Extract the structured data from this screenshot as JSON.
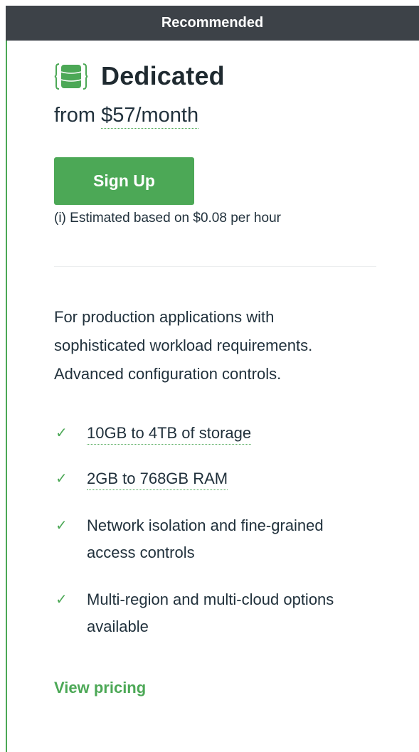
{
  "banner": {
    "label": "Recommended"
  },
  "plan": {
    "icon": "database-icon",
    "title": "Dedicated",
    "price_prefix": "from",
    "price_value": "$57/month",
    "signup_label": "Sign Up",
    "estimate_note": "(i) Estimated based on $0.08 per hour"
  },
  "description": {
    "lines": [
      "For production applications with",
      "sophisticated workload requirements.",
      "Advanced configuration controls."
    ]
  },
  "features": [
    {
      "lines": [
        "10GB to 4TB of storage"
      ],
      "icon": "check-icon"
    },
    {
      "lines": [
        "2GB to 768GB RAM"
      ],
      "icon": "check-icon"
    },
    {
      "lines": [
        "Network isolation and fine-grained",
        "access controls"
      ],
      "icon": "check-icon"
    },
    {
      "lines": [
        "Multi-region and multi-cloud options",
        "available"
      ],
      "icon": "check-icon"
    }
  ],
  "link": {
    "view_pricing": "View pricing"
  },
  "colors": {
    "accent": "#4ca856",
    "banner_bg": "#3d4248",
    "text": "#21313c"
  }
}
